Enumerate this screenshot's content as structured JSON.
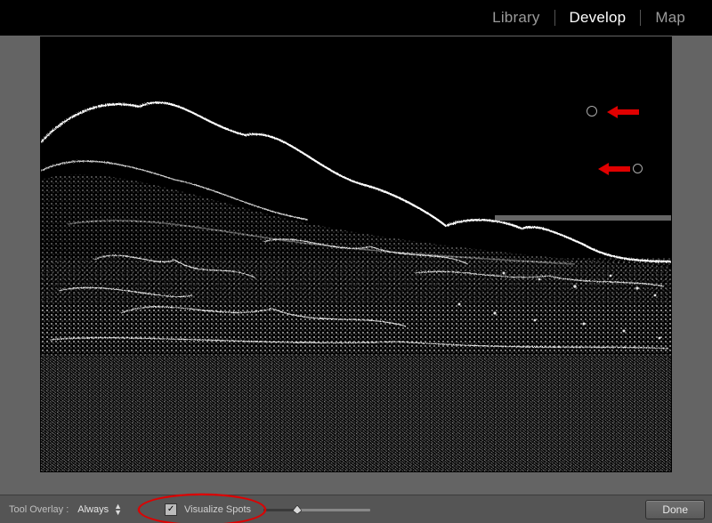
{
  "modules": {
    "library": "Library",
    "develop": "Develop",
    "map": "Map",
    "active": "develop"
  },
  "toolbar": {
    "tool_overlay_label": "Tool Overlay :",
    "tool_overlay_value": "Always",
    "visualize_spots_label": "Visualize Spots",
    "visualize_spots_checked": true,
    "slider_value": 32,
    "done_label": "Done"
  },
  "annotations": {
    "arrow_color": "#e00000",
    "highlight_color": "#e00000"
  }
}
